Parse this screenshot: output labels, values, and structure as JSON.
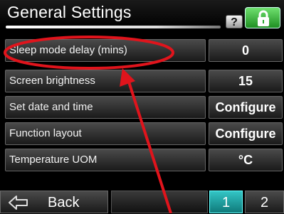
{
  "header": {
    "title": "General Settings",
    "help_label": "?",
    "lock_icon": "lock-icon",
    "accent_color": "#2aa82e"
  },
  "rows": [
    {
      "label": "Sleep mode delay (mins)",
      "value": "0"
    },
    {
      "label": "Screen brightness",
      "value": "15"
    },
    {
      "label": "Set date and time",
      "value": "Configure"
    },
    {
      "label": "Function layout",
      "value": "Configure"
    },
    {
      "label": "Temperature UOM",
      "value": "°C"
    }
  ],
  "footer": {
    "back_label": "Back",
    "back_icon": "back-arrow-icon",
    "pages": [
      "1",
      "2"
    ],
    "active_page": "1",
    "active_color": "#1fa3a3"
  },
  "annotation": {
    "color": "#e0141c"
  }
}
